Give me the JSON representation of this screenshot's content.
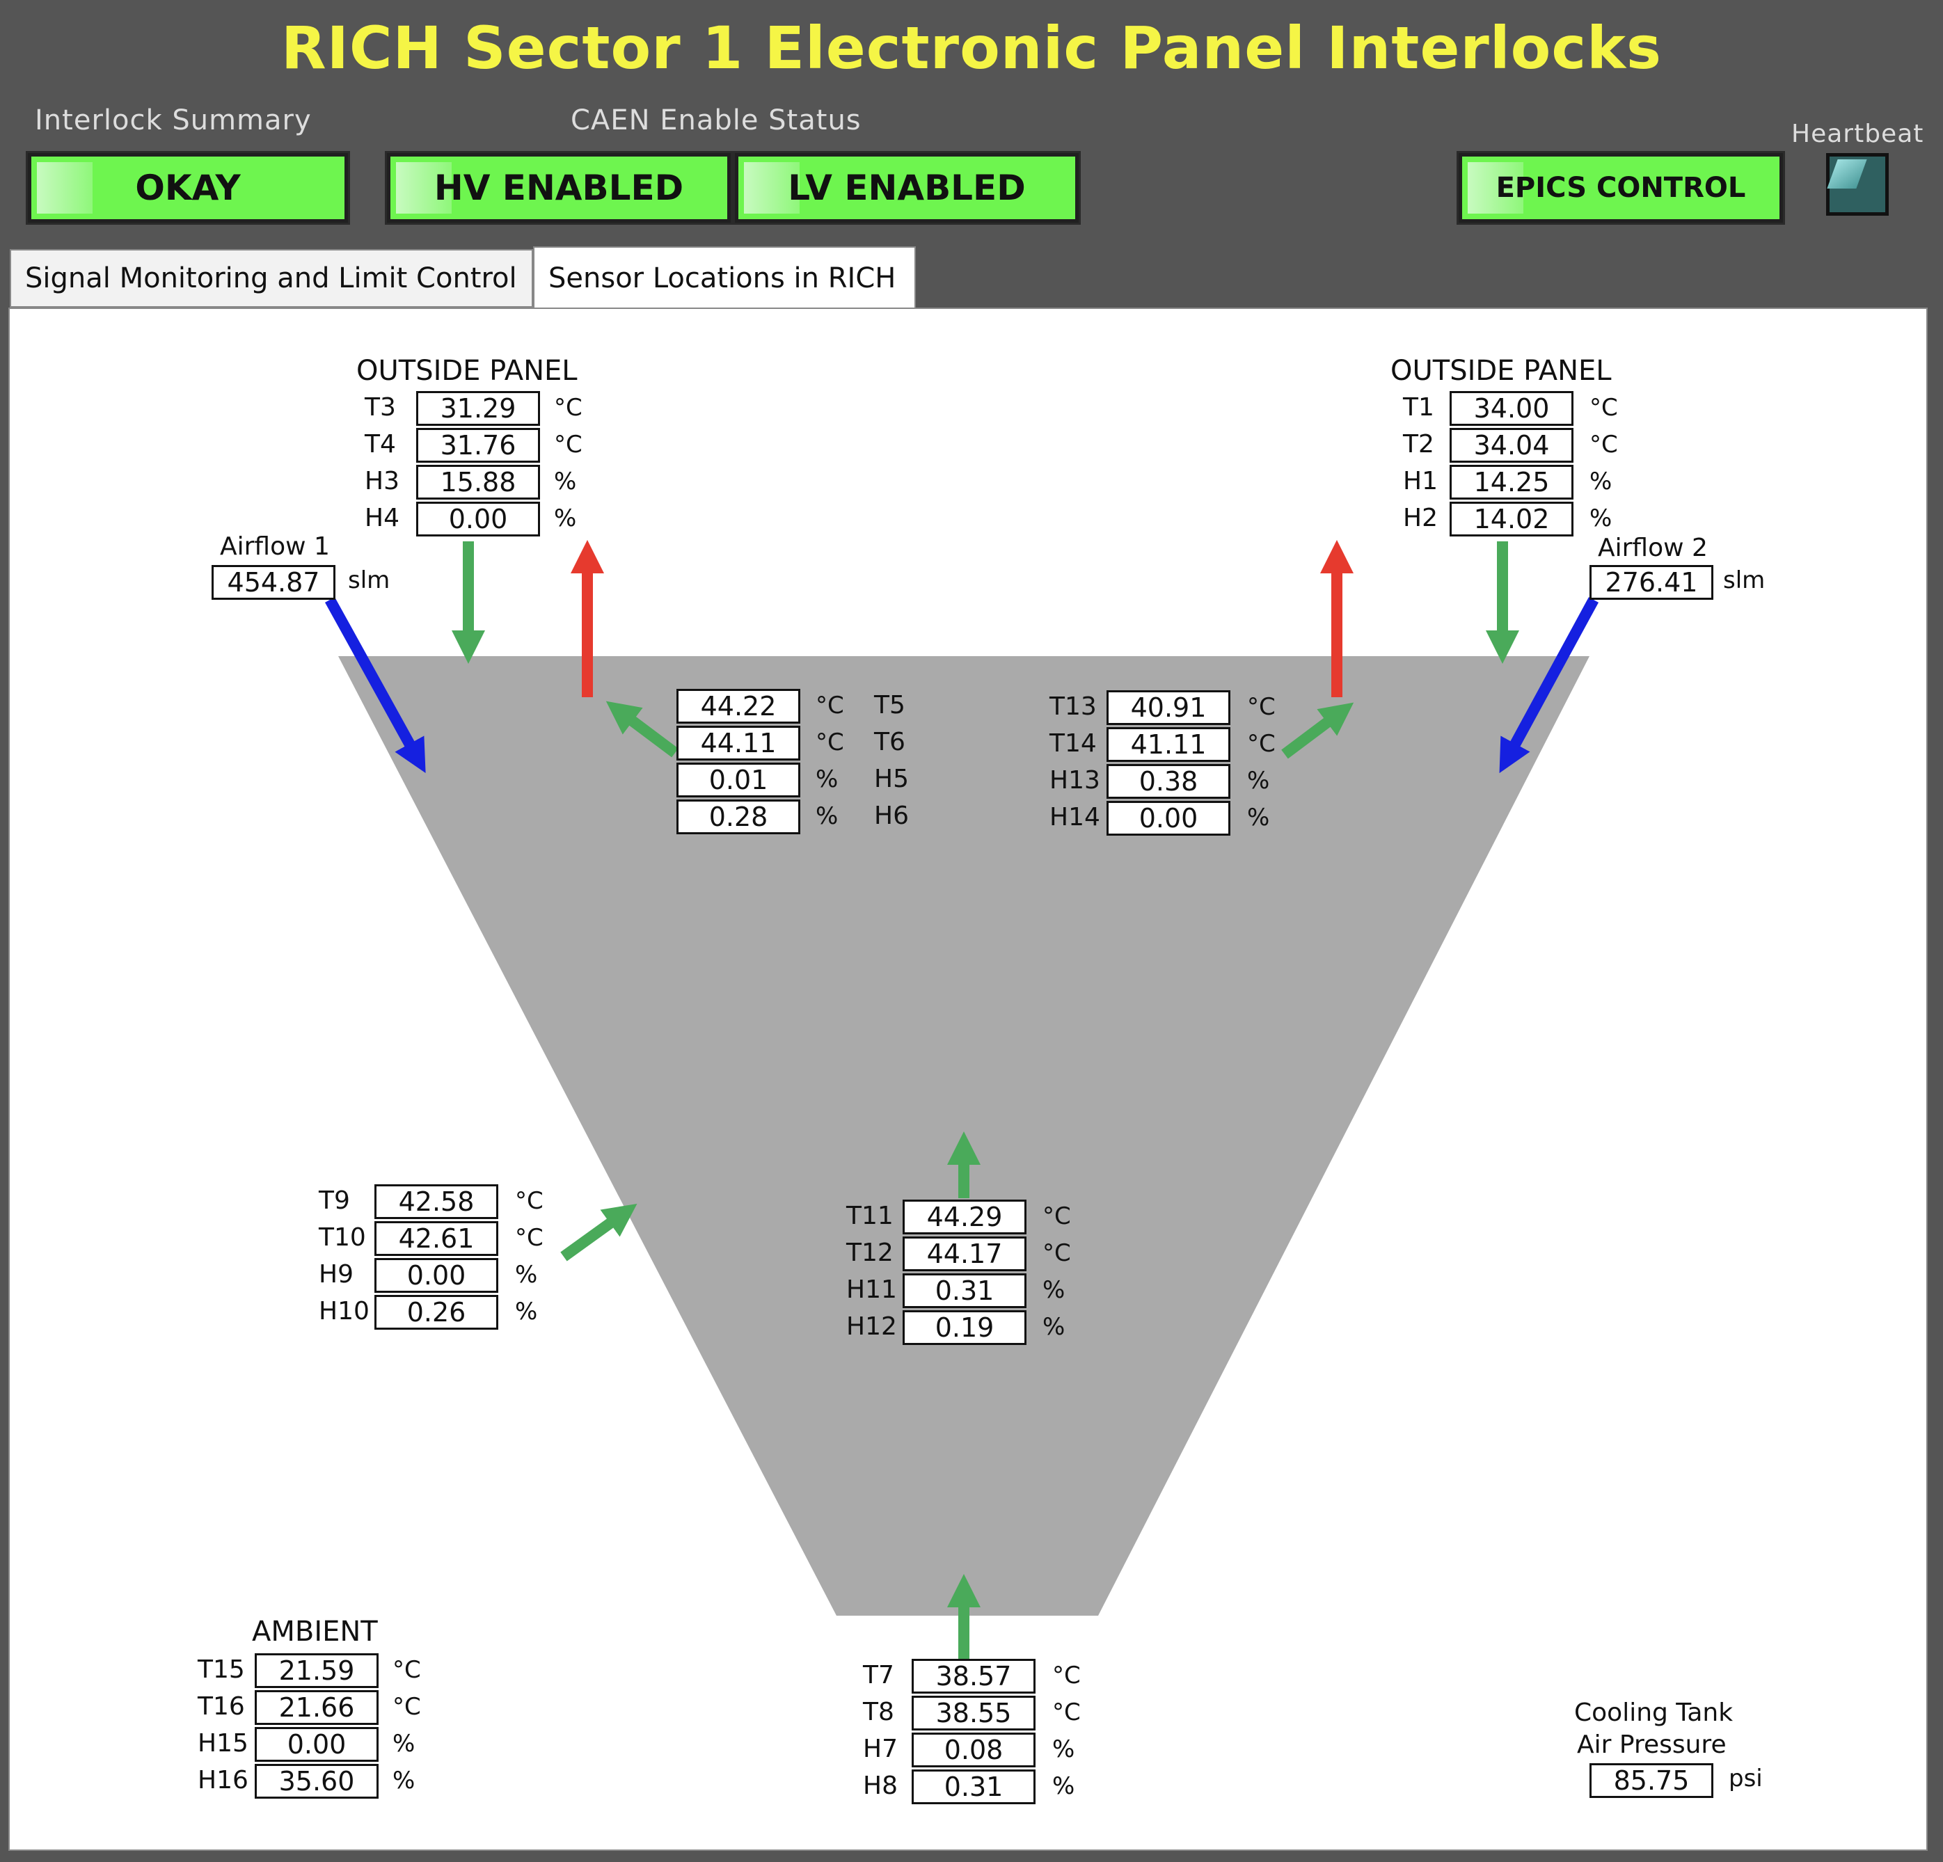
{
  "title": "RICH Sector 1 Electronic Panel Interlocks",
  "header": {
    "interlock_summary_label": "Interlock Summary",
    "caen_label": "CAEN Enable Status",
    "heartbeat_label": "Heartbeat",
    "okay": "OKAY",
    "hv": "HV ENABLED",
    "lv": "LV ENABLED",
    "epics": "EPICS CONTROL",
    "status_color": "#6ef54f"
  },
  "tabs": [
    {
      "label": "Signal Monitoring and Limit Control"
    },
    {
      "label": "Sensor Locations in RICH"
    }
  ],
  "groups": {
    "outside_left": {
      "title": "OUTSIDE PANEL",
      "sensors": [
        {
          "name": "T3",
          "value": "31.29",
          "unit": "°C"
        },
        {
          "name": "T4",
          "value": "31.76",
          "unit": "°C"
        },
        {
          "name": "H3",
          "value": "15.88",
          "unit": "%"
        },
        {
          "name": "H4",
          "value": "0.00",
          "unit": "%"
        }
      ]
    },
    "outside_right": {
      "title": "OUTSIDE PANEL",
      "sensors": [
        {
          "name": "T1",
          "value": "34.00",
          "unit": "°C"
        },
        {
          "name": "T2",
          "value": "34.04",
          "unit": "°C"
        },
        {
          "name": "H1",
          "value": "14.25",
          "unit": "%"
        },
        {
          "name": "H2",
          "value": "14.02",
          "unit": "%"
        }
      ]
    },
    "top_center_left": {
      "sensors": [
        {
          "name": "T5",
          "value": "44.22",
          "unit": "°C"
        },
        {
          "name": "T6",
          "value": "44.11",
          "unit": "°C"
        },
        {
          "name": "H5",
          "value": "0.01",
          "unit": "%"
        },
        {
          "name": "H6",
          "value": "0.28",
          "unit": "%"
        }
      ]
    },
    "top_center_right": {
      "sensors": [
        {
          "name": "T13",
          "value": "40.91",
          "unit": "°C"
        },
        {
          "name": "T14",
          "value": "41.11",
          "unit": "°C"
        },
        {
          "name": "H13",
          "value": "0.38",
          "unit": "%"
        },
        {
          "name": "H14",
          "value": "0.00",
          "unit": "%"
        }
      ]
    },
    "left_mid": {
      "sensors": [
        {
          "name": "T9",
          "value": "42.58",
          "unit": "°C"
        },
        {
          "name": "T10",
          "value": "42.61",
          "unit": "°C"
        },
        {
          "name": "H9",
          "value": "0.00",
          "unit": "%"
        },
        {
          "name": "H10",
          "value": "0.26",
          "unit": "%"
        }
      ]
    },
    "center_mid": {
      "sensors": [
        {
          "name": "T11",
          "value": "44.29",
          "unit": "°C"
        },
        {
          "name": "T12",
          "value": "44.17",
          "unit": "°C"
        },
        {
          "name": "H11",
          "value": "0.31",
          "unit": "%"
        },
        {
          "name": "H12",
          "value": "0.19",
          "unit": "%"
        }
      ]
    },
    "ambient": {
      "title": "AMBIENT",
      "sensors": [
        {
          "name": "T15",
          "value": "21.59",
          "unit": "°C"
        },
        {
          "name": "T16",
          "value": "21.66",
          "unit": "°C"
        },
        {
          "name": "H15",
          "value": "0.00",
          "unit": "%"
        },
        {
          "name": "H16",
          "value": "35.60",
          "unit": "%"
        }
      ]
    },
    "bottom": {
      "sensors": [
        {
          "name": "T7",
          "value": "38.57",
          "unit": "°C"
        },
        {
          "name": "T8",
          "value": "38.55",
          "unit": "°C"
        },
        {
          "name": "H7",
          "value": "0.08",
          "unit": "%"
        },
        {
          "name": "H8",
          "value": "0.31",
          "unit": "%"
        }
      ]
    }
  },
  "airflow1": {
    "label": "Airflow 1",
    "value": "454.87",
    "unit": "slm"
  },
  "airflow2": {
    "label": "Airflow 2",
    "value": "276.41",
    "unit": "slm"
  },
  "cooling": {
    "line1": "Cooling Tank",
    "line2": "Air Pressure",
    "value": "85.75",
    "unit": "psi"
  },
  "colors": {
    "funnel": "#aaaaaa",
    "green_arrow": "#4aaa5a",
    "red_arrow": "#e63a2e",
    "blue_arrow": "#1520e0"
  }
}
